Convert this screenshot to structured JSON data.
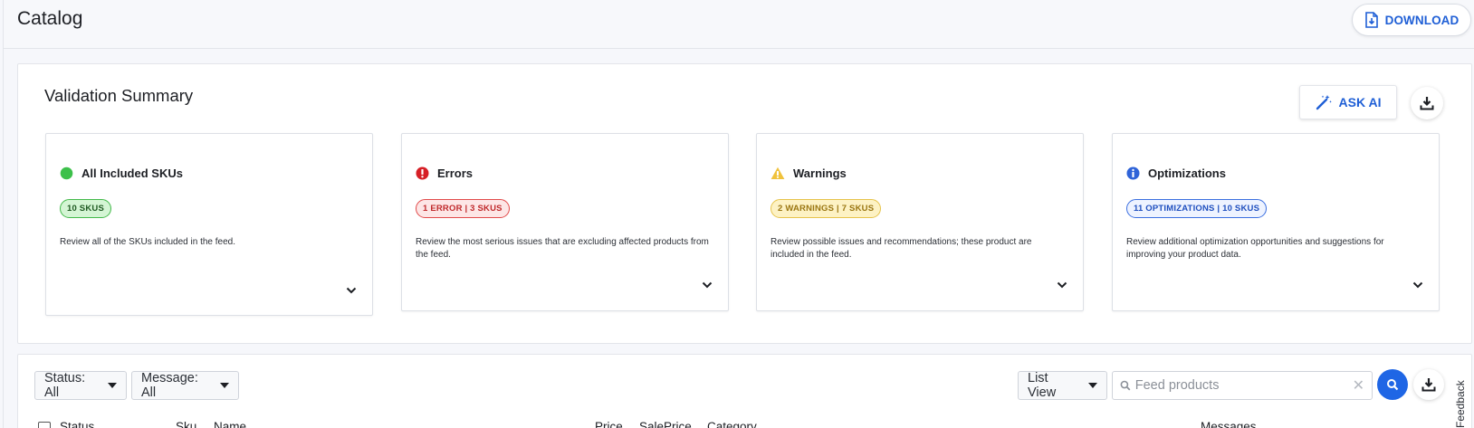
{
  "header": {
    "title": "Catalog",
    "download_label": "DOWNLOAD"
  },
  "validation": {
    "title": "Validation Summary",
    "ask_ai_label": "ASK AI",
    "cards": [
      {
        "title": "All Included SKUs",
        "badge": "10 SKUS",
        "description": "Review all of the SKUs included in the feed.",
        "icon": "green-dot-icon",
        "color": "#3cc04a"
      },
      {
        "title": "Errors",
        "badge": "1 ERROR | 3 SKUS",
        "description": "Review the most serious issues that are excluding affected products from the feed.",
        "icon": "error-icon",
        "color": "#d61f26"
      },
      {
        "title": "Warnings",
        "badge": "2 WARNINGS | 7 SKUS",
        "description": "Review possible issues and recommendations; these product are included in the feed.",
        "icon": "warning-icon",
        "color": "#f0c23c"
      },
      {
        "title": "Optimizations",
        "badge": "11 OPTIMIZATIONS | 10 SKUS",
        "description": "Review additional optimization opportunities and suggestions for improving your product data.",
        "icon": "info-icon",
        "color": "#2f63d8"
      }
    ]
  },
  "filters": {
    "status": "Status: All",
    "message": "Message: All",
    "view": "List View",
    "search_placeholder": "Feed products"
  },
  "table": {
    "columns": [
      "Status",
      "Sku",
      "Name",
      "Price",
      "SalePrice",
      "Category",
      "Messages"
    ]
  },
  "feedback_label": "Feedback",
  "colors": {
    "accent": "#1f66e5",
    "brand_text": "#1f5fd6"
  }
}
